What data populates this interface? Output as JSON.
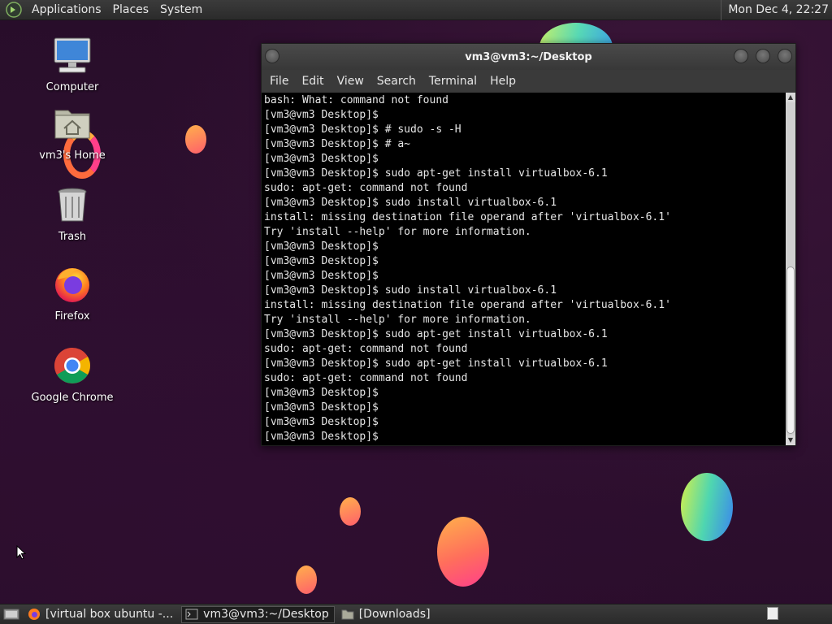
{
  "top_panel": {
    "menus": [
      "Applications",
      "Places",
      "System"
    ],
    "clock": "Mon Dec 4, 22:27"
  },
  "desktop_icons": [
    {
      "label": "Computer",
      "icon": "computer-icon"
    },
    {
      "label": "vm3's Home",
      "icon": "home-folder-icon"
    },
    {
      "label": "Trash",
      "icon": "trash-icon"
    },
    {
      "label": "Firefox",
      "icon": "firefox-icon"
    },
    {
      "label": "Google Chrome",
      "icon": "chrome-icon"
    }
  ],
  "terminal": {
    "title": "vm3@vm3:~/Desktop",
    "menus": [
      "File",
      "Edit",
      "View",
      "Search",
      "Terminal",
      "Help"
    ],
    "lines": [
      "bash: What: command not found",
      "[vm3@vm3 Desktop]$",
      "[vm3@vm3 Desktop]$ # sudo -s -H",
      "[vm3@vm3 Desktop]$ # a~",
      "[vm3@vm3 Desktop]$",
      "[vm3@vm3 Desktop]$ sudo apt-get install virtualbox-6.1",
      "sudo: apt-get: command not found",
      "[vm3@vm3 Desktop]$ sudo install virtualbox-6.1",
      "install: missing destination file operand after 'virtualbox-6.1'",
      "Try 'install --help' for more information.",
      "[vm3@vm3 Desktop]$",
      "[vm3@vm3 Desktop]$",
      "[vm3@vm3 Desktop]$",
      "[vm3@vm3 Desktop]$ sudo install virtualbox-6.1",
      "install: missing destination file operand after 'virtualbox-6.1'",
      "Try 'install --help' for more information.",
      "[vm3@vm3 Desktop]$ sudo apt-get install virtualbox-6.1",
      "sudo: apt-get: command not found",
      "[vm3@vm3 Desktop]$ sudo apt-get install virtualbox-6.1",
      "sudo: apt-get: command not found",
      "[vm3@vm3 Desktop]$",
      "[vm3@vm3 Desktop]$",
      "[vm3@vm3 Desktop]$",
      "[vm3@vm3 Desktop]$"
    ]
  },
  "taskbar": {
    "tasks": [
      {
        "label": "[virtual box ubuntu -...",
        "icon": "firefox-icon",
        "active": false
      },
      {
        "label": "vm3@vm3:~/Desktop",
        "icon": "terminal-icon",
        "active": true
      },
      {
        "label": "[Downloads]",
        "icon": "folder-icon",
        "active": false
      }
    ]
  },
  "colors": {
    "desktop_bg": "#2a0f2b",
    "panel_bg": "#333333",
    "terminal_bg": "#000000",
    "terminal_fg": "#e6e6e6"
  }
}
